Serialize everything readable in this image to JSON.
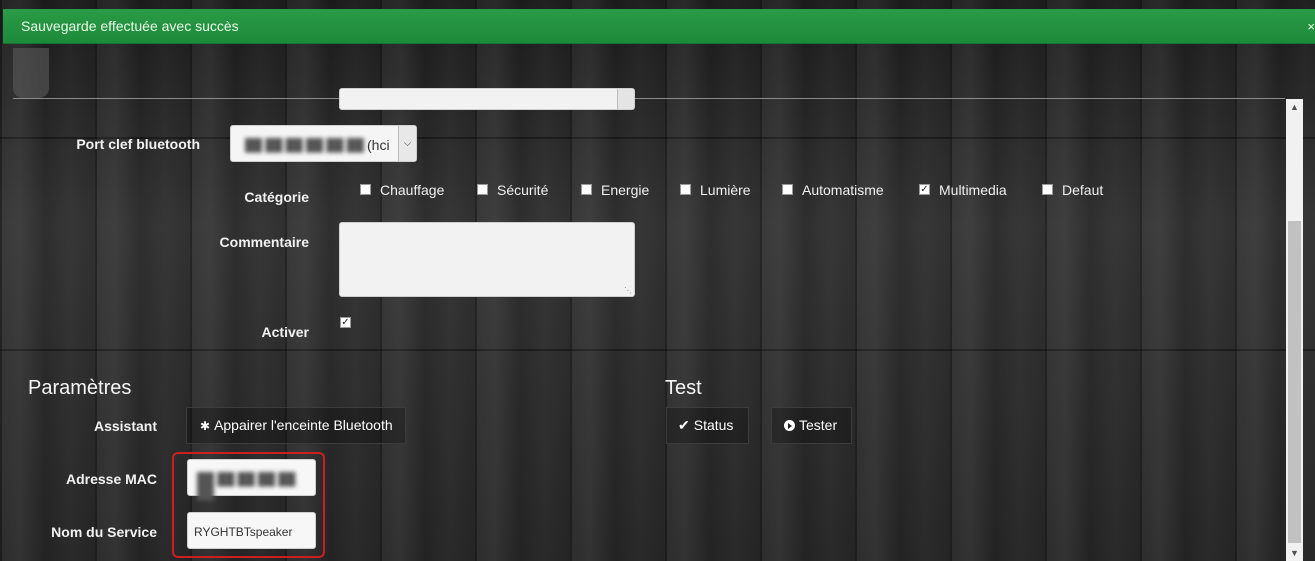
{
  "notification": {
    "text": "Sauvegarde effectuée avec succès",
    "close": "×"
  },
  "form": {
    "port_label": "Port clef bluetooth",
    "port_value_suffix": "(hci",
    "category_label": "Catégorie",
    "categories": [
      {
        "label": "Chauffage",
        "checked": false
      },
      {
        "label": "Sécurité",
        "checked": false
      },
      {
        "label": "Energie",
        "checked": false
      },
      {
        "label": "Lumière",
        "checked": false
      },
      {
        "label": "Automatisme",
        "checked": false
      },
      {
        "label": "Multimedia",
        "checked": true
      },
      {
        "label": "Defaut",
        "checked": false
      }
    ],
    "comment_label": "Commentaire",
    "activate_label": "Activer",
    "activate_checked": true
  },
  "parametres": {
    "title": "Paramètres",
    "assistant_label": "Assistant",
    "pair_button": "Appairer l'enceinte Bluetooth",
    "mac_label": "Adresse MAC",
    "service_label": "Nom du Service",
    "service_value": "RYGHTBTspeaker"
  },
  "test": {
    "title": "Test",
    "status_button": "Status",
    "tester_button": "Tester"
  },
  "icons": {
    "check": "check-icon",
    "bluetooth": "bluetooth-icon",
    "play": "play-circle-icon"
  },
  "colors": {
    "success": "#1e8a3b",
    "highlight": "#cc1f1f"
  }
}
